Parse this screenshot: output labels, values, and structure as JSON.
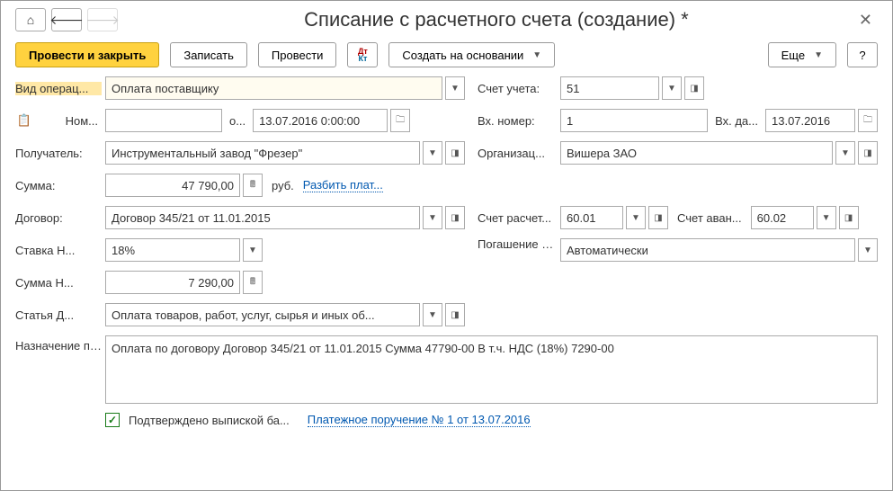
{
  "title": "Списание с расчетного счета (создание) *",
  "toolbar": {
    "post_and_close": "Провести и закрыть",
    "save": "Записать",
    "post": "Провести",
    "create_based": "Создать на основании",
    "more": "Еще",
    "help": "?"
  },
  "left": {
    "operation_type_label": "Вид операц...",
    "operation_type_value": "Оплата поставщику",
    "number_label": "Ном...",
    "number_value": "",
    "date_prefix": "о...",
    "date_value": "13.07.2016  0:00:00",
    "recipient_label": "Получатель:",
    "recipient_value": "Инструментальный завод \"Фрезер\"",
    "amount_label": "Сумма:",
    "amount_value": "47 790,00",
    "currency": "руб.",
    "split_link": "Разбить плат...",
    "contract_label": "Договор:",
    "contract_value": "Договор 345/21 от 11.01.2015",
    "vat_rate_label": "Ставка Н...",
    "vat_rate_value": "18%",
    "vat_amount_label": "Сумма Н...",
    "vat_amount_value": "7 290,00",
    "cashflow_label": "Статья Д...",
    "cashflow_value": "Оплата товаров, работ, услуг, сырья и иных об..."
  },
  "right": {
    "account_label": "Счет учета:",
    "account_value": "51",
    "in_number_label": "Вх. номер:",
    "in_number_value": "1",
    "in_date_label": "Вх. да...",
    "in_date_value": "13.07.2016",
    "org_label": "Организац...",
    "org_value": "Вишера ЗАО",
    "settle_account_label": "Счет расчет...",
    "settle_account_value": "60.01",
    "advance_account_label": "Счет аван...",
    "advance_account_value": "60.02",
    "debt_label": "Погашение задолженно...",
    "debt_value": "Автоматически"
  },
  "purpose": {
    "label": "Назначение платежа:",
    "value": "Оплата по договору Договор 345/21 от 11.01.2015 Сумма 47790-00 В т.ч. НДС  (18%) 7290-00"
  },
  "footer": {
    "confirmed_label": "Подтверждено выпиской ба...",
    "link": "Платежное поручение № 1 от 13.07.2016"
  }
}
